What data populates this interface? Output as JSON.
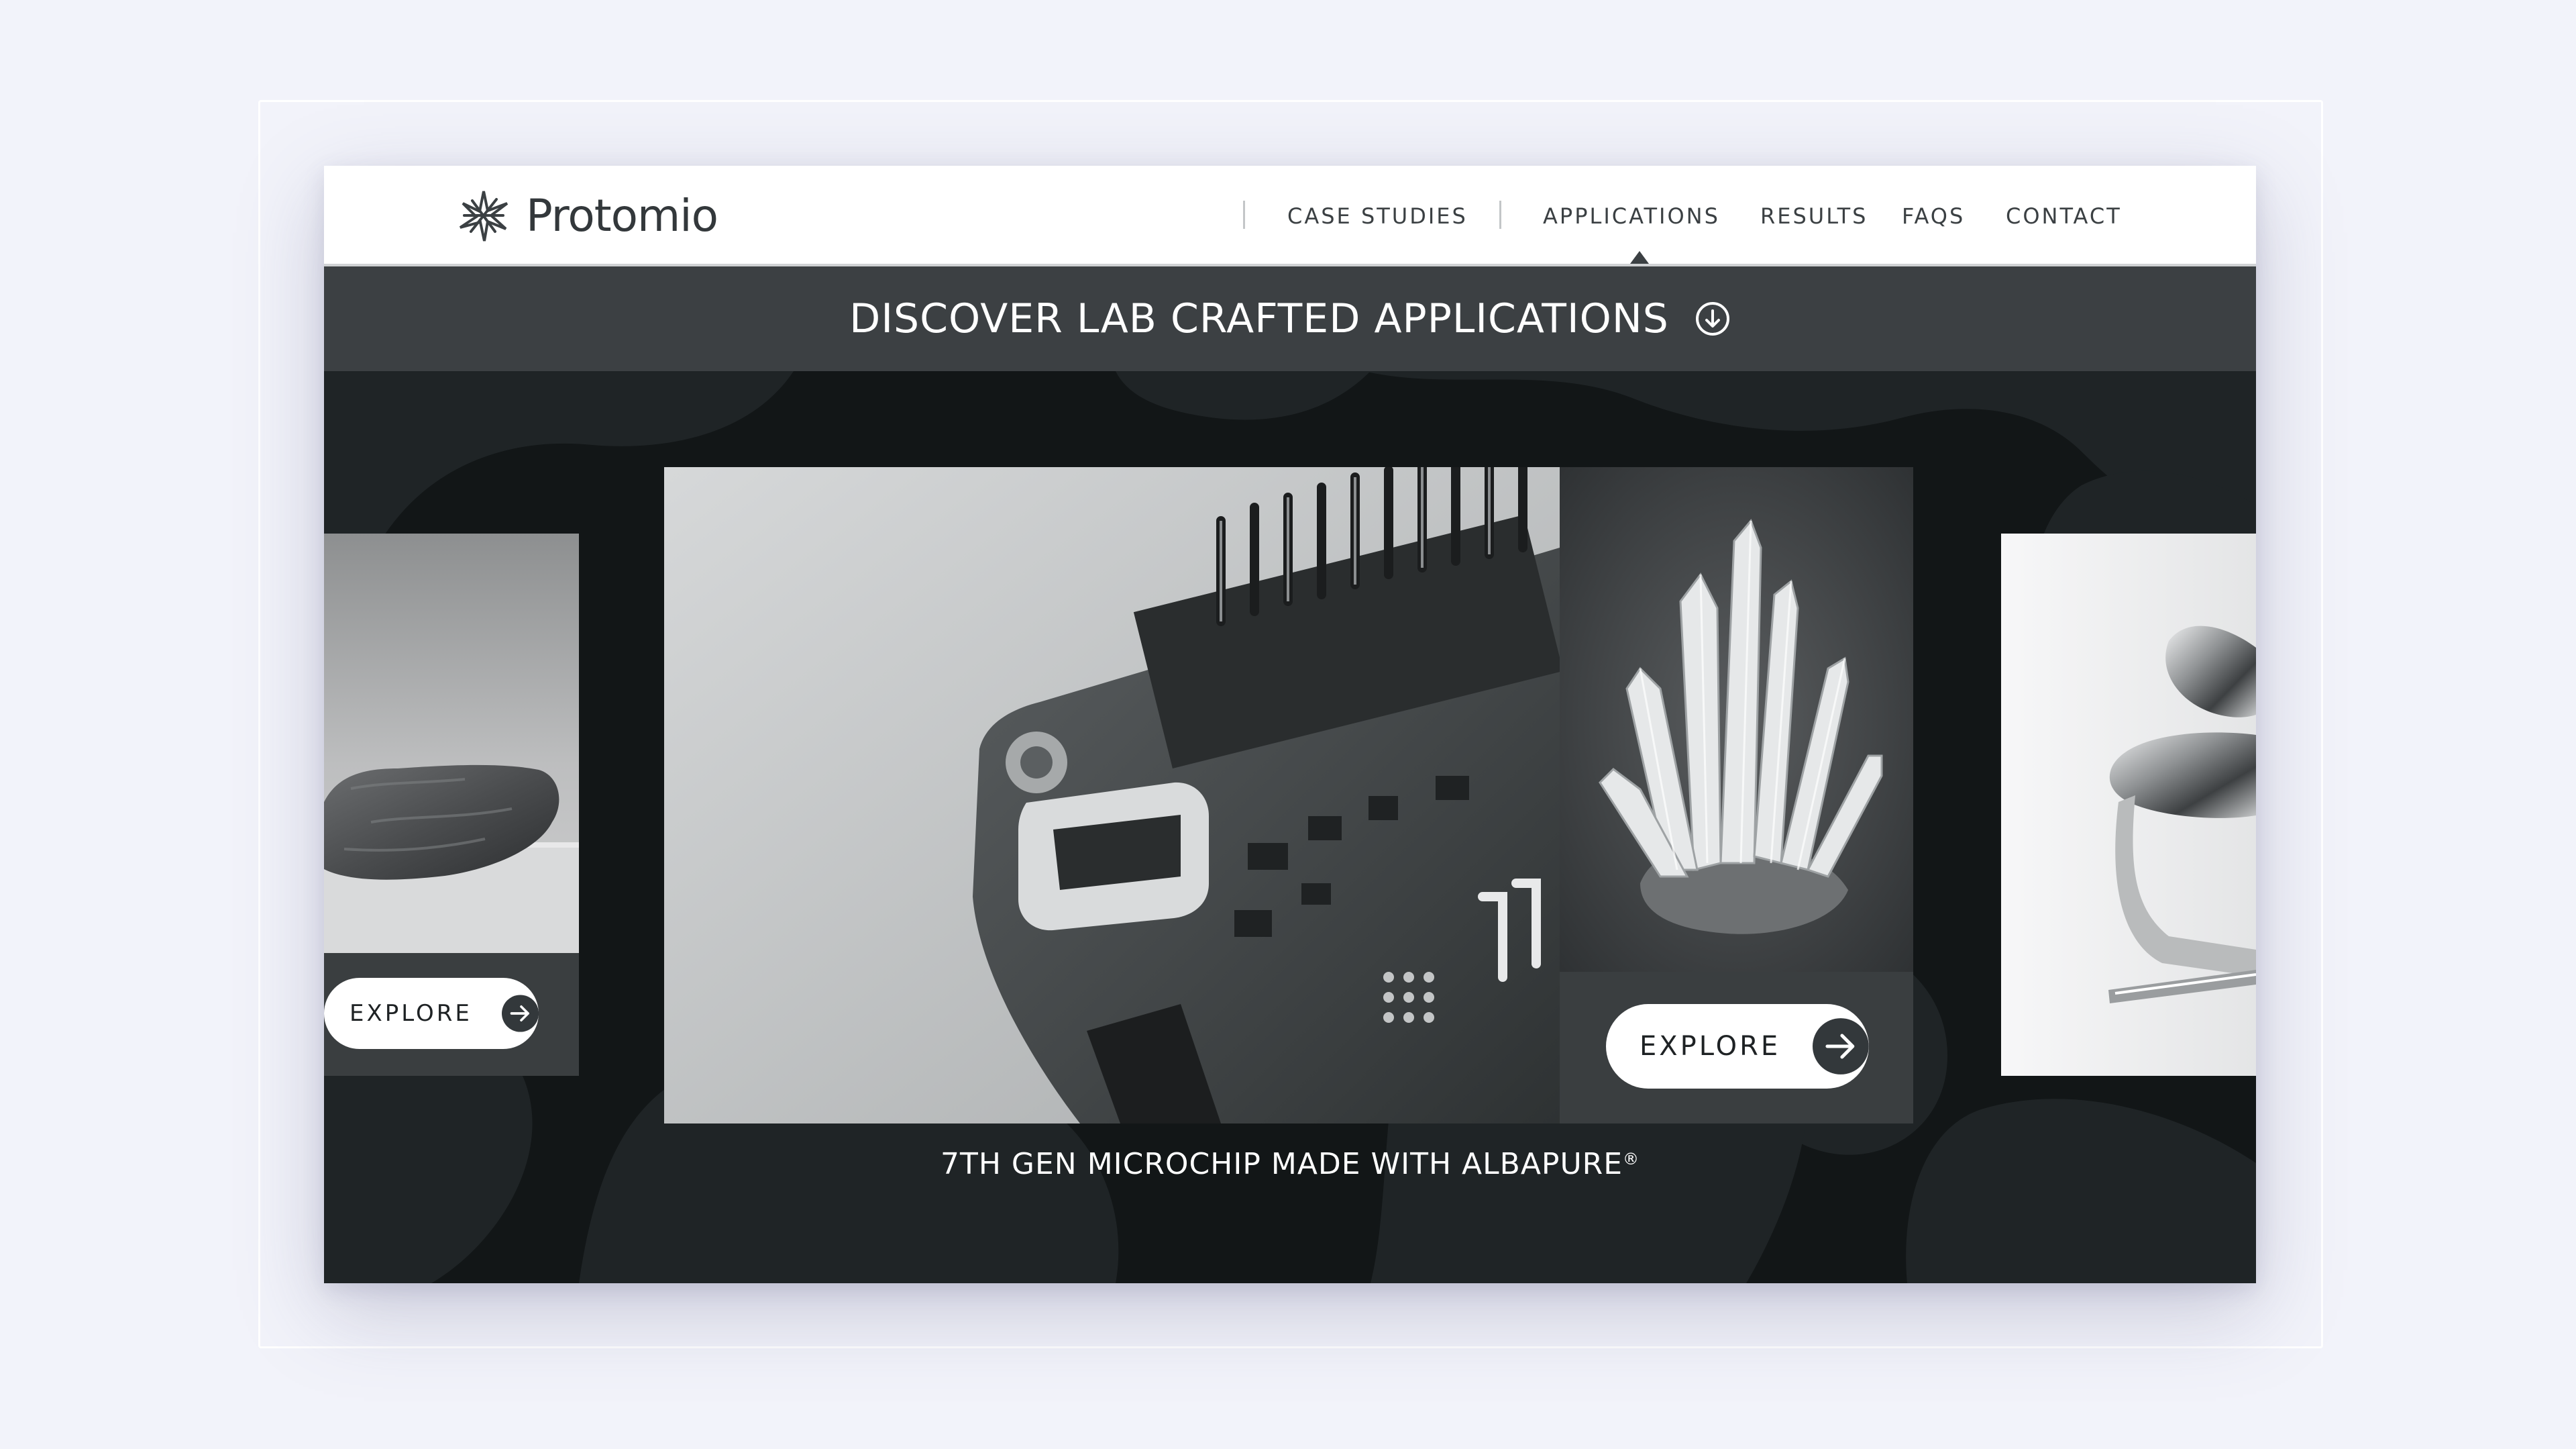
{
  "brand": {
    "name": "Protomio",
    "logo_icon": "starburst-logo-icon"
  },
  "nav": {
    "items": [
      {
        "label": "CASE STUDIES"
      },
      {
        "label": "APPLICATIONS",
        "active": true
      },
      {
        "label": "RESULTS"
      },
      {
        "label": "FAQS"
      },
      {
        "label": "CONTACT"
      }
    ]
  },
  "banner": {
    "title": "DISCOVER LAB CRAFTED APPLICATIONS",
    "icon": "arrow-down-circle-icon"
  },
  "carousel": {
    "slides": [
      {
        "image": "rock-photo",
        "button_label": "EXPLORE",
        "button_icon": "arrow-right-icon"
      },
      {
        "image": "microchip-board-photo",
        "caption": "7TH GEN MICROCHIP MADE WITH ALBAPURE",
        "caption_mark": "®"
      },
      {
        "image": "crystal-cluster-photo",
        "button_label": "EXPLORE",
        "button_icon": "arrow-right-icon"
      },
      {
        "image": "metal-spoons-photo"
      }
    ]
  },
  "colors": {
    "page_bg": "#f2f3fa",
    "header_bg": "#ffffff",
    "banner_bg": "#3c4043",
    "stage_bg": "#121617",
    "button_bg": "#ffffff",
    "button_icon_bg": "#33383b"
  }
}
